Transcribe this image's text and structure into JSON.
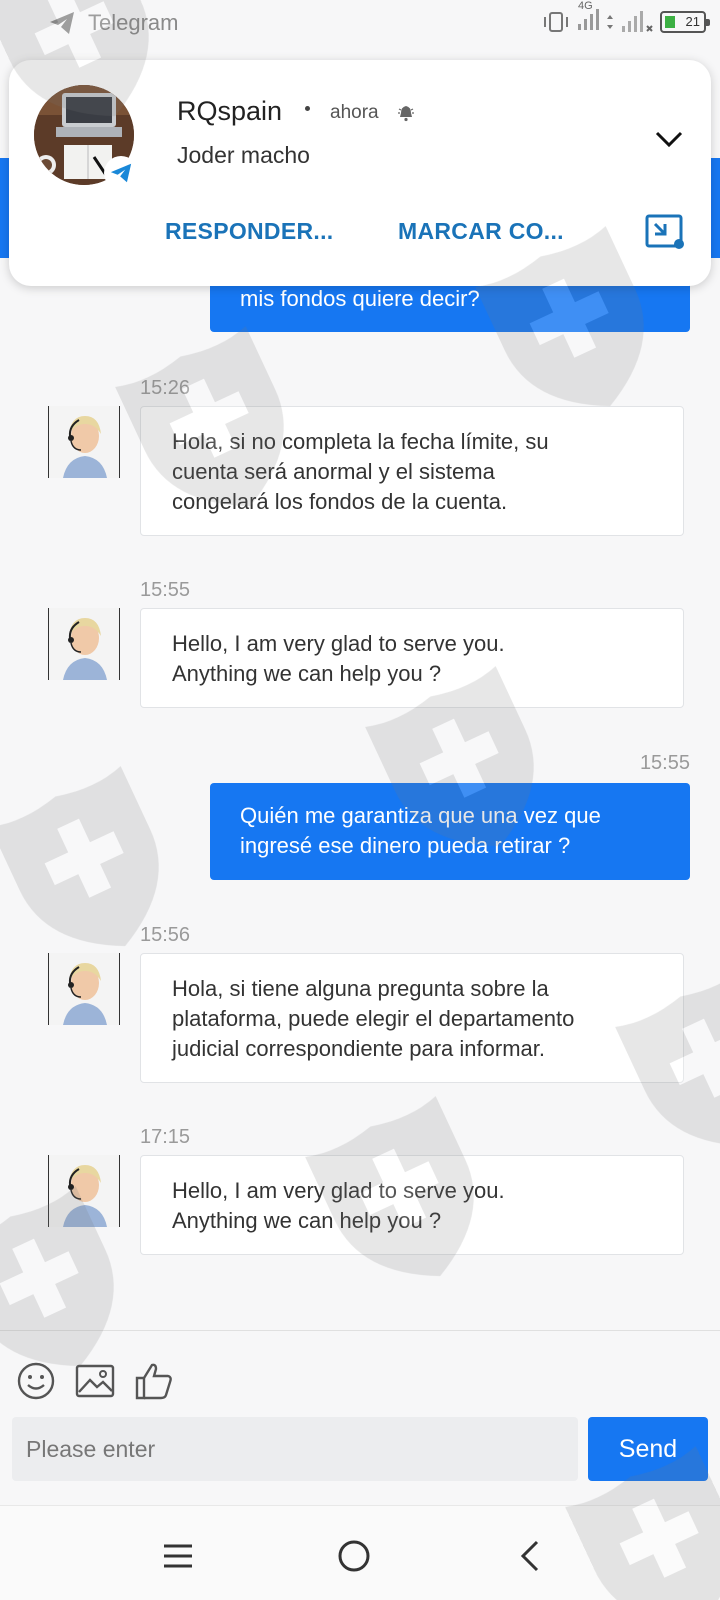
{
  "status_bar": {
    "app_name": "Telegram",
    "network": "4G",
    "battery": "21"
  },
  "notification": {
    "sender": "RQspain",
    "time": "ahora",
    "message": "Joder macho",
    "actions": [
      "RESPONDER...",
      "MARCAR CO..."
    ]
  },
  "messages": [
    {
      "side": "right",
      "lines": [
        "mis fondos quiere decir?"
      ]
    },
    {
      "side": "left",
      "time": "15:26",
      "lines": [
        "Hola, si no completa la fecha límite, su",
        "cuenta será anormal y el sistema",
        "congelará los fondos de la cuenta."
      ]
    },
    {
      "side": "left",
      "time": "15:55",
      "lines": [
        "Hello, I am very glad to serve you.",
        "Anything we can help you ?"
      ]
    },
    {
      "side": "right",
      "time": "15:55",
      "lines": [
        "Quién me garantiza que una vez que",
        "ingresé ese dinero pueda retirar ?"
      ]
    },
    {
      "side": "left",
      "time": "15:56",
      "lines": [
        "Hola, si tiene alguna pregunta sobre la",
        "plataforma, puede elegir el departamento",
        "judicial correspondiente para informar."
      ]
    },
    {
      "side": "left",
      "time": "17:15",
      "lines": [
        "Hello, I am very glad to serve you.",
        "Anything we can help you ?"
      ]
    }
  ],
  "composer": {
    "placeholder": "Please enter",
    "send_label": "Send",
    "tools": [
      "emoji-icon",
      "image-icon",
      "thumbs-up-icon"
    ]
  },
  "nav": [
    "menu-icon",
    "home-icon",
    "back-icon"
  ],
  "colors": {
    "accent": "#1677f2",
    "action_text": "#1a73b8"
  }
}
